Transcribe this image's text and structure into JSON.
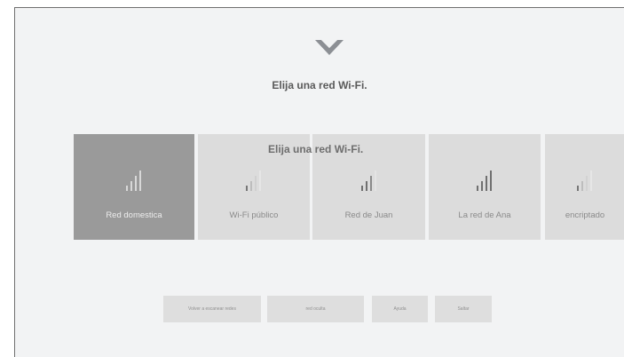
{
  "title": "Elija una red Wi-Fi.",
  "overlay_title": "Elija una red Wi-Fi.",
  "networks": [
    {
      "label": "Red domestica",
      "selected": true
    },
    {
      "label": "Wi-Fi público",
      "selected": false
    },
    {
      "label": "Red de Juan",
      "selected": false
    },
    {
      "label": "La red de Ana",
      "selected": false
    },
    {
      "label": "encriptado",
      "selected": false
    }
  ],
  "buttons": {
    "rescan": "Volver a escanear redes",
    "hidden": "red oculta",
    "help": "Ayuda",
    "skip": "Saltar"
  },
  "colors": {
    "background": "#f2f3f4",
    "card": "#dcdcdc",
    "card_selected": "#9a9a9a"
  },
  "icons": [
    "brand-chevron-logo",
    "wifi-signal-icon"
  ]
}
